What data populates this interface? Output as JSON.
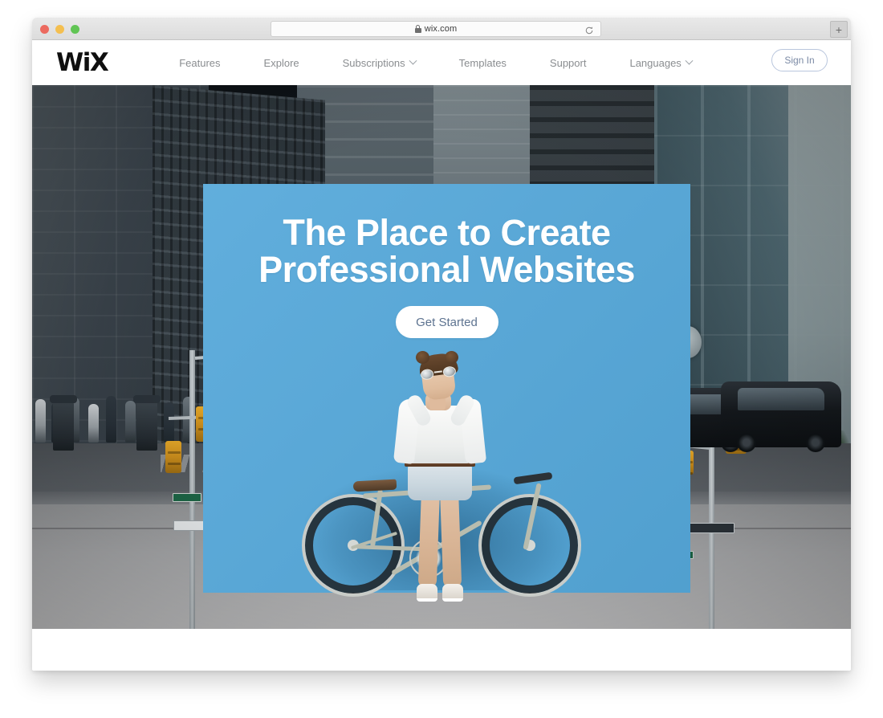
{
  "browser": {
    "traffic_lights": [
      {
        "name": "close",
        "color": "#ec6a5f"
      },
      {
        "name": "minimize",
        "color": "#f4bf50"
      },
      {
        "name": "maximize",
        "color": "#61c554"
      }
    ],
    "address_bar": {
      "url": "wix.com",
      "lock_icon": "lock-icon",
      "reload_icon": "reload-icon"
    },
    "new_tab_label": "+"
  },
  "site": {
    "logo": "WiX",
    "nav": [
      {
        "label": "Features",
        "has_chevron": false
      },
      {
        "label": "Explore",
        "has_chevron": false
      },
      {
        "label": "Subscriptions",
        "has_chevron": true
      },
      {
        "label": "Templates",
        "has_chevron": false
      },
      {
        "label": "Support",
        "has_chevron": false
      },
      {
        "label": "Languages",
        "has_chevron": true
      }
    ],
    "sign_in_label": "Sign In"
  },
  "hero": {
    "title_line1": "The Place to Create",
    "title_line2": "Professional Websites",
    "cta_label": "Get Started",
    "panel_color": "#55a8da",
    "title_color": "#ffffff",
    "cta_text_color": "#5d7390"
  }
}
